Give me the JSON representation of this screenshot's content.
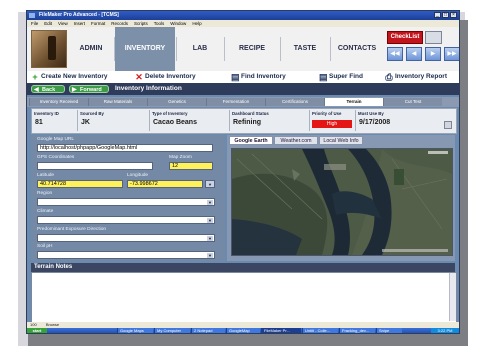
{
  "window": {
    "title": "FileMaker Pro Advanced - [TCMS]",
    "menu": [
      "File",
      "Edit",
      "View",
      "Insert",
      "Format",
      "Records",
      "Scripts",
      "Tools",
      "Window",
      "Help"
    ]
  },
  "nav": {
    "tabs": [
      "ADMIN",
      "INVENTORY",
      "LAB",
      "RECIPE",
      "TASTE",
      "CONTACTS"
    ],
    "active": "INVENTORY",
    "checklist_label": "CheckList"
  },
  "actions": {
    "create": "Create New Inventory",
    "delete": "Delete Inventory",
    "find": "Find Inventory",
    "super_find": "Super Find",
    "report": "Inventory Report"
  },
  "infobar": {
    "back": "Back",
    "forward": "Forward",
    "title": "Inventory Information"
  },
  "tabs": [
    "Inventory Received",
    "Raw Materials",
    "Genetics",
    "Fermentation",
    "Certifications",
    "Terrain",
    "Cut Test"
  ],
  "active_tab": "Terrain",
  "header": {
    "inventory_id_label": "Inventory ID",
    "inventory_id": "81",
    "sourced_by_label": "Sourced By",
    "sourced_by": "JK",
    "type_label": "Type of Inventory",
    "type": "Cacao Beans",
    "status_label": "Dashboard Status",
    "status": "Refining",
    "priority_label": "Priority of Use",
    "priority": "High",
    "use_by_label": "Must Use By",
    "use_by": "9/17/2008"
  },
  "form": {
    "map_url_label": "Google Map URL",
    "map_url": "http://localhost/phpapp/GoogleMap.html",
    "gps_label": "GPS Coordinates",
    "zoom_label": "Map Zoom",
    "zoom": "12",
    "latitude_label": "Latitude",
    "latitude": "40.714728",
    "longitude_label": "Longitude",
    "longitude": "-73.998672",
    "region_label": "Region",
    "climate_label": "Climate",
    "exposure_label": "Predominant Exposure Direction",
    "soil_label": "Soil pH"
  },
  "map_tabs": [
    "Google Earth",
    "Weather.com",
    "Local Web Info"
  ],
  "active_map_tab": "Google Earth",
  "notes": {
    "label": "Terrain Notes"
  },
  "status": {
    "text": "100",
    "browse": "Browse"
  },
  "taskbar": {
    "start": "start",
    "items": [
      "Google Maps",
      "My Computer",
      "2 Notepad",
      "GoogleMap",
      "FileMaker Pr...",
      "Untitl - Colle...",
      "Fracking_dev...",
      "Snipe"
    ],
    "clock": "3:22 PM"
  },
  "colors": {
    "nav_active": "#7c90a9",
    "priority_high": "#e31515",
    "checklist": "#c2141c",
    "zoom_field": "#fff15a",
    "info_bar": "#2f3b5a"
  }
}
